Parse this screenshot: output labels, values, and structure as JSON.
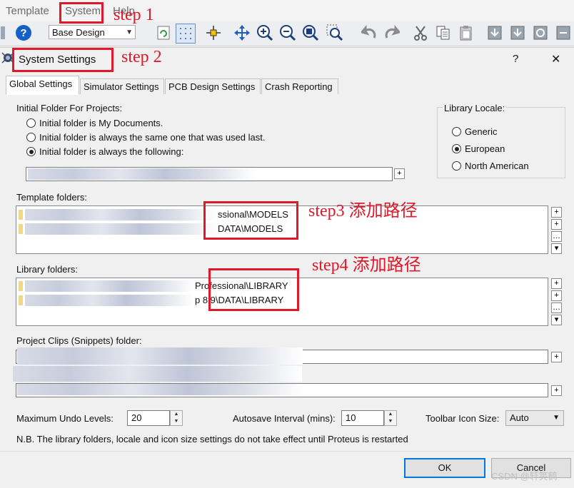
{
  "menu": {
    "items": [
      "Template",
      "System",
      "Help"
    ]
  },
  "toolbar": {
    "design_combo": "Base Design",
    "icons": [
      "help-icon",
      "refresh-icon",
      "grid-icon",
      "origin-icon",
      "pan-icon",
      "zoom-in-icon",
      "zoom-out-icon",
      "zoom-all-icon",
      "zoom-area-icon",
      "undo-icon",
      "redo-icon",
      "cut-icon",
      "copy-icon",
      "paste-icon",
      "block-copy-icon",
      "block-move-icon",
      "block-rotate-icon",
      "block-delete-icon"
    ]
  },
  "dialog": {
    "title": "System Settings",
    "help_glyph": "?",
    "close_glyph": "✕",
    "tabs": [
      "Global Settings",
      "Simulator Settings",
      "PCB Design Settings",
      "Crash Reporting"
    ],
    "initial_folder": {
      "label": "Initial Folder For Projects:",
      "options": [
        {
          "label": "Initial folder is My Documents.",
          "selected": false
        },
        {
          "label": "Initial folder is always the same one that was used last.",
          "selected": false
        },
        {
          "label": "Initial folder is always the following:",
          "selected": true
        }
      ]
    },
    "library_locale": {
      "label": "Library Locale:",
      "options": [
        {
          "label": "Generic",
          "selected": false
        },
        {
          "label": "European",
          "selected": true
        },
        {
          "label": "North American",
          "selected": false
        }
      ]
    },
    "template_folders": {
      "label": "Template folders:",
      "rows": [
        "ssional\\MODELS",
        "DATA\\MODELS"
      ]
    },
    "library_folders": {
      "label": "Library folders:",
      "rows": [
        "Professional\\LIBRARY",
        "p 8.9\\DATA\\LIBRARY"
      ]
    },
    "clips_folder": {
      "label": "Project Clips (Snippets) folder:"
    },
    "list_buttons": [
      "+",
      "+",
      "…",
      "▾"
    ],
    "browse_glyph": "+",
    "undo_levels": {
      "label": "Maximum Undo Levels:",
      "value": "20"
    },
    "autosave": {
      "label": "Autosave Interval (mins):",
      "value": "10"
    },
    "icon_size": {
      "label": "Toolbar Icon Size:",
      "value": "Auto"
    },
    "note": "N.B. The library folders, locale and icon size settings do not take effect until Proteus is restarted",
    "ok_label": "OK",
    "cancel_label": "Cancel"
  },
  "annotations": {
    "step1": "step 1",
    "step2": "step 2",
    "step3": "step3 添加路径",
    "step4": "step4 添加路径"
  },
  "watermark": "CSDN @轩笑鹤",
  "colors": {
    "accent": "#0078d7",
    "annotation": "#e0182a"
  }
}
